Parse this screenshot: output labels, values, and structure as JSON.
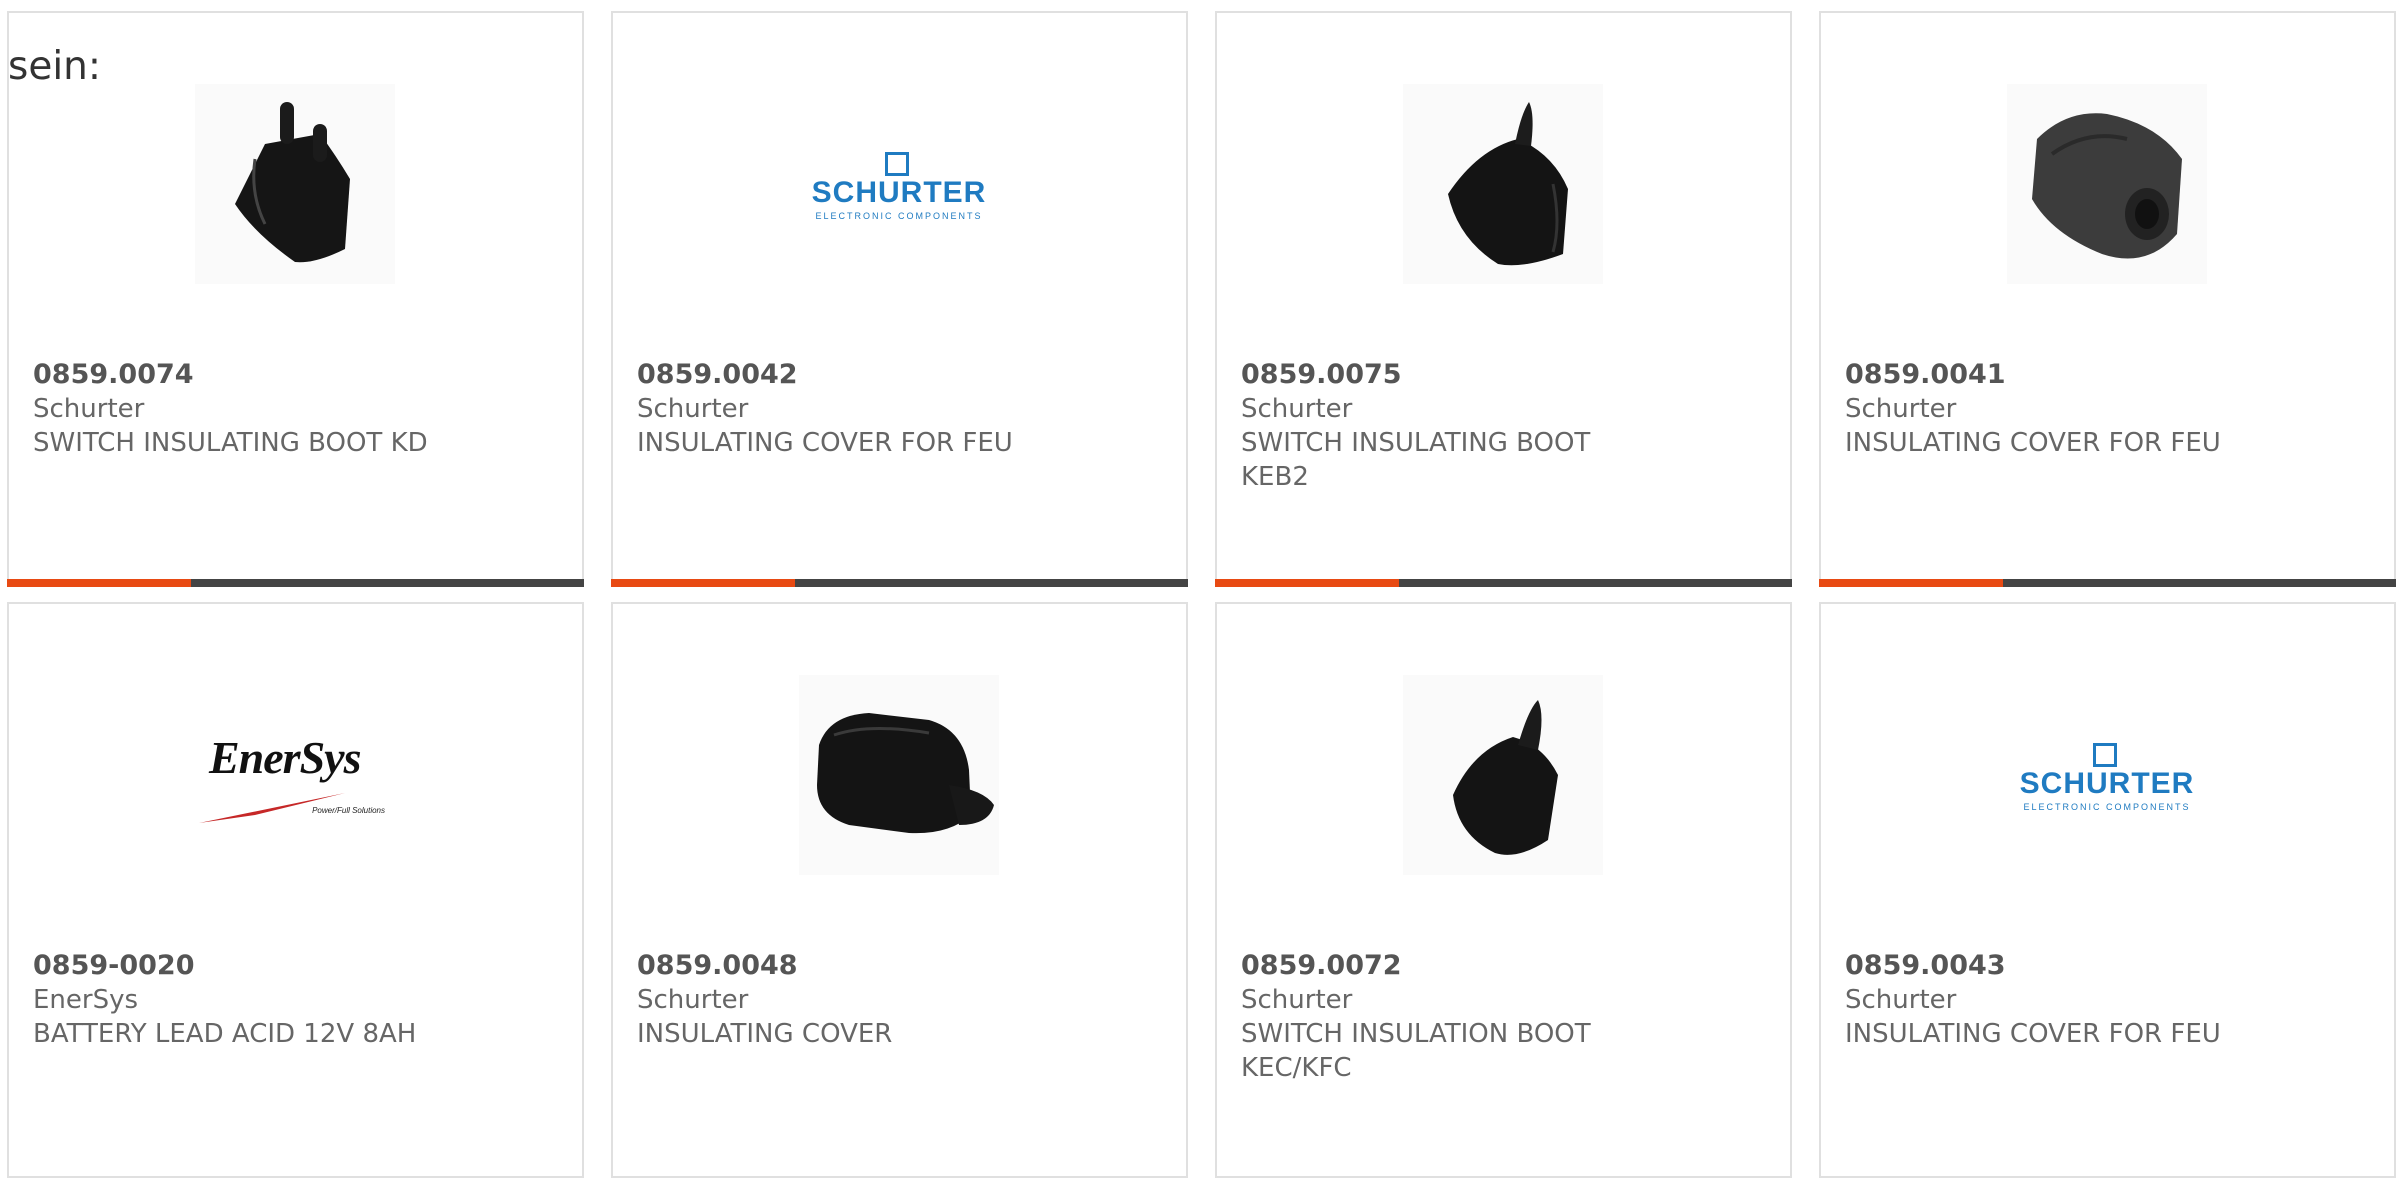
{
  "intro": "sein:",
  "cards": [
    {
      "part": "0859.0074",
      "mfr": "Schurter",
      "desc": "SWITCH INSULATING BOOT KD",
      "image": "boot-kd-image"
    },
    {
      "part": "0859.0042",
      "mfr": "Schurter",
      "desc": "INSULATING COVER FOR FEU",
      "image": "schurter-logo"
    },
    {
      "part": "0859.0075",
      "mfr": "Schurter",
      "desc": "SWITCH INSULATING BOOT KEB2",
      "image": "boot-keb2-image"
    },
    {
      "part": "0859.0041",
      "mfr": "Schurter",
      "desc": "INSULATING COVER FOR FEU",
      "image": "cover-feu-image"
    },
    {
      "part": "0859-0020",
      "mfr": "EnerSys",
      "desc": "BATTERY LEAD ACID 12V 8AH",
      "image": "enersys-logo"
    },
    {
      "part": "0859.0048",
      "mfr": "Schurter",
      "desc": "INSULATING COVER",
      "image": "cover-image"
    },
    {
      "part": "0859.0072",
      "mfr": "Schurter",
      "desc": "SWITCH INSULATION BOOT KEC/KFC",
      "image": "boot-kec-image"
    },
    {
      "part": "0859.0043",
      "mfr": "Schurter",
      "desc": "INSULATING COVER FOR FEU",
      "image": "schurter-logo"
    }
  ],
  "logos": {
    "schurter_name": "SCHURTER",
    "schurter_sub": "ELECTRONIC COMPONENTS",
    "enersys_name": "EnerSys",
    "enersys_sub": "Power/Full Solutions"
  },
  "colors": {
    "accent": "#e84a13",
    "bar": "#444444",
    "schurter_blue": "#1f7bc1"
  }
}
